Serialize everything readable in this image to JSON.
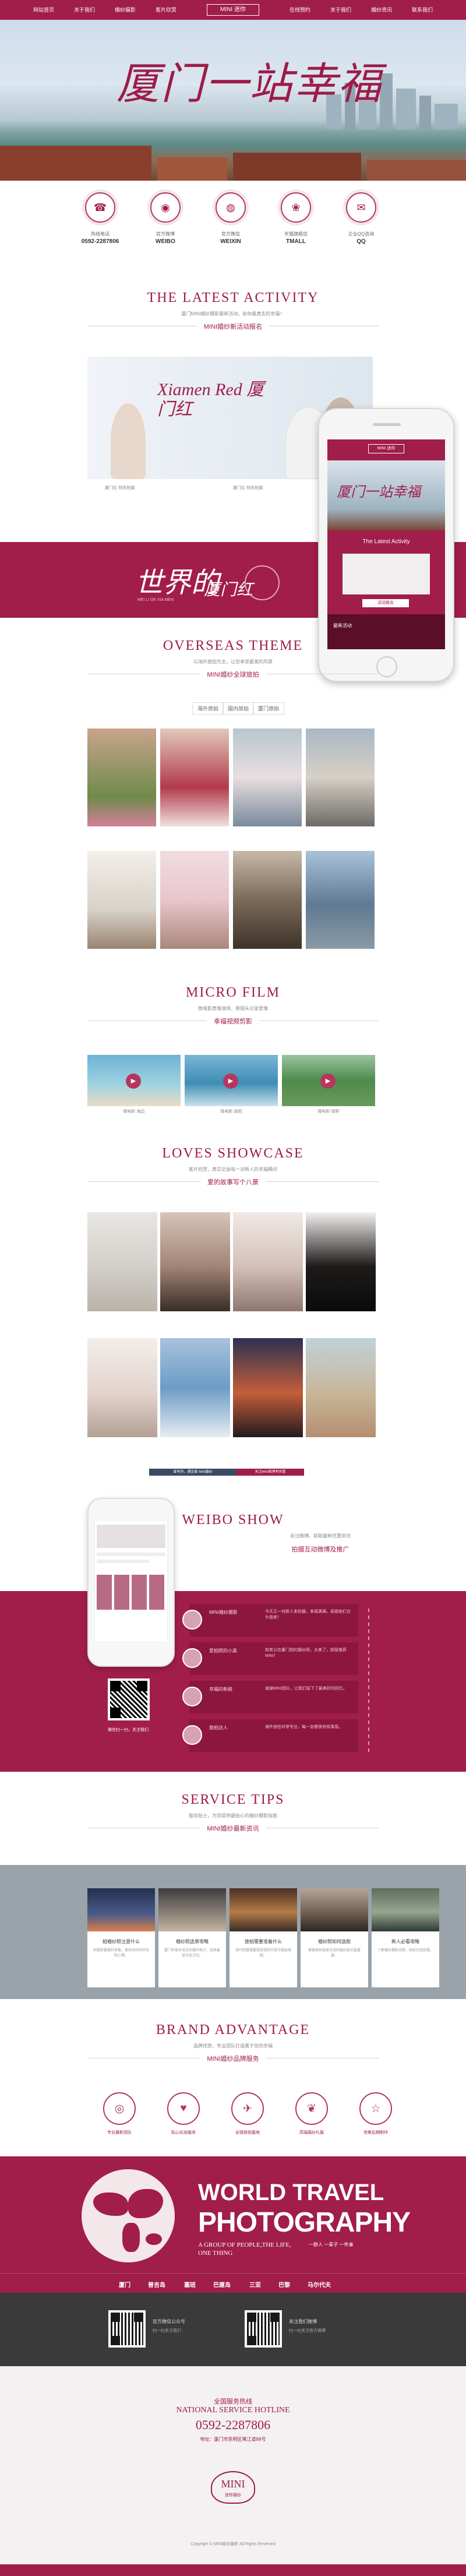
{
  "nav": {
    "items_left": [
      "网站首页",
      "关于我们",
      "婚纱摄影",
      "客片欣赏"
    ],
    "logo": "MINI 迷你",
    "items_right": [
      "在线预约",
      "关于我们",
      "婚纱资讯",
      "联系我们"
    ]
  },
  "hero": {
    "title": "厦门一站幸福"
  },
  "contact": [
    {
      "icon": "☎",
      "label": "热线电话",
      "value": "0592-2287806"
    },
    {
      "icon": "◉",
      "label": "官方微博",
      "value": "WEIBO"
    },
    {
      "icon": "◍",
      "label": "官方微信",
      "value": "WEIXIN"
    },
    {
      "icon": "❀",
      "label": "天猫旗舰店",
      "value": "TMALL"
    },
    {
      "icon": "✉",
      "label": "企业QQ咨询",
      "value": "QQ"
    }
  ],
  "activity": {
    "title": "THE LATEST ACTIVITY",
    "subtitle": "厦门MINI婚纱摄影最新活动，给你最真实的幸福！",
    "line": "MINI婚纱新活动报名",
    "banner_text": "Xiamen Red 厦门红",
    "banner_cap1": "厦门红·特色拍摄",
    "banner_cap2": "厦门红·特色拍摄"
  },
  "band1": {
    "script": "世界的",
    "script2": "厦门红",
    "sub": "MEI LI DE XIA MEN"
  },
  "overseas": {
    "title": "OVERSEAS THEME",
    "subtitle": "以海外旅拍为主，让您享受最美的风景",
    "line": "MINI婚纱全球旅拍",
    "tabs": [
      "海外旅拍",
      "国内旅拍",
      "厦门旅拍"
    ]
  },
  "microfilm": {
    "title": "MICRO FILM",
    "subtitle": "微电影真情演绎，用镜头记录爱情",
    "line": "幸福视频剪影",
    "films": [
      "微电影·海边",
      "微电影·旅拍",
      "微电影·绿野"
    ]
  },
  "loves": {
    "title": "LOVES SHOWCASE",
    "subtitle": "客片欣赏，真实记录每一对新人的幸福瞬间",
    "line": "爱的故事写个八景"
  },
  "weibo": {
    "title": "WEIBO SHOW",
    "subtitle": "关注微博，获取最新优惠资讯",
    "line": "拍摄互动微博及推广",
    "caption1": "爱有你，遇见爱·Mini婚纱",
    "caption2": "关注Mini微博有惊喜",
    "qr_label": "微信扫一扫，关注我们",
    "posts": [
      {
        "user": "MINI婚纱摄影",
        "text": "今天又一对新人来拍摄，幸福满满，祝福他们白头偕老！"
      },
      {
        "user": "爱拍照的小美",
        "text": "和老公在厦门拍的婚纱照，太美了，超级推荐MINI！"
      },
      {
        "user": "幸福的新娘",
        "text": "谢谢MINI团队，让我们留下了最美好的回忆。"
      },
      {
        "user": "旅拍达人",
        "text": "海外旅拍非常专业，每一张都很有故事感。"
      }
    ]
  },
  "service": {
    "title": "SERVICE TIPS",
    "subtitle": "服务贴士，为您提供最贴心的婚纱摄影指南",
    "line": "MINI婚纱最新资讯",
    "tips": [
      {
        "title": "拍婚纱照注意什么",
        "text": "拍摄前要做好准备，保持良好的状态和心情。"
      },
      {
        "title": "婚纱照选景攻略",
        "text": "厦门有很多适合拍摄的地方，选择最适合自己的。"
      },
      {
        "title": "旅拍需要准备什么",
        "text": "旅行拍摄需要提前规划行程与服装搭配。"
      },
      {
        "title": "婚纱照如何选款",
        "text": "根据身材选择合适的婚纱款式最重要。"
      },
      {
        "title": "新人必看攻略",
        "text": "了解婚纱摄影流程，轻松完成拍摄。"
      }
    ]
  },
  "brand": {
    "title": "BRAND ADVANTAGE",
    "subtitle": "品牌优势，专业团队打造属于您的幸福",
    "line": "MINI婚纱品牌服务",
    "items": [
      {
        "icon": "◎",
        "label": "专业摄影团队"
      },
      {
        "icon": "♥",
        "label": "贴心化妆服务"
      },
      {
        "icon": "✈",
        "label": "全球旅拍基地"
      },
      {
        "icon": "❦",
        "label": "高端婚纱礼服"
      },
      {
        "icon": "☆",
        "label": "完美后期制作"
      }
    ]
  },
  "world": {
    "title1": "WORLD TRAVEL",
    "title2": "PHOTOGRAPHY",
    "tag1": "A GROUP OF PEOPLE,THE LIFE,",
    "tag2": "ONE THING",
    "tag3": "一群人 一辈子 一件事"
  },
  "world_nav": [
    "厦门",
    "普吉岛",
    "塞班",
    "巴厘岛",
    "三亚",
    "巴黎",
    "马尔代夫"
  ],
  "qr_section": {
    "left_title": "官方微信公众号",
    "left_text": "扫一扫关注我们",
    "right_title": "关注我们微博",
    "right_text": "扫一扫关注官方微博"
  },
  "footer": {
    "line1": "全国服务热线",
    "line2": "NATIONAL SERVICE HOTLINE",
    "phone": "0592-2287806",
    "address": "地址：厦门市思明区鹭江道88号",
    "logo": "MINI",
    "logo_sub": "迷你婚纱",
    "copyright": "Copyright © MINI婚纱摄影 All Rights Reserved"
  },
  "phone_mock": {
    "header": "MINI 迷你",
    "title": "厦门一站幸福",
    "section": "The Latest Activity",
    "btn": "活动报名",
    "link": "最新活动"
  }
}
